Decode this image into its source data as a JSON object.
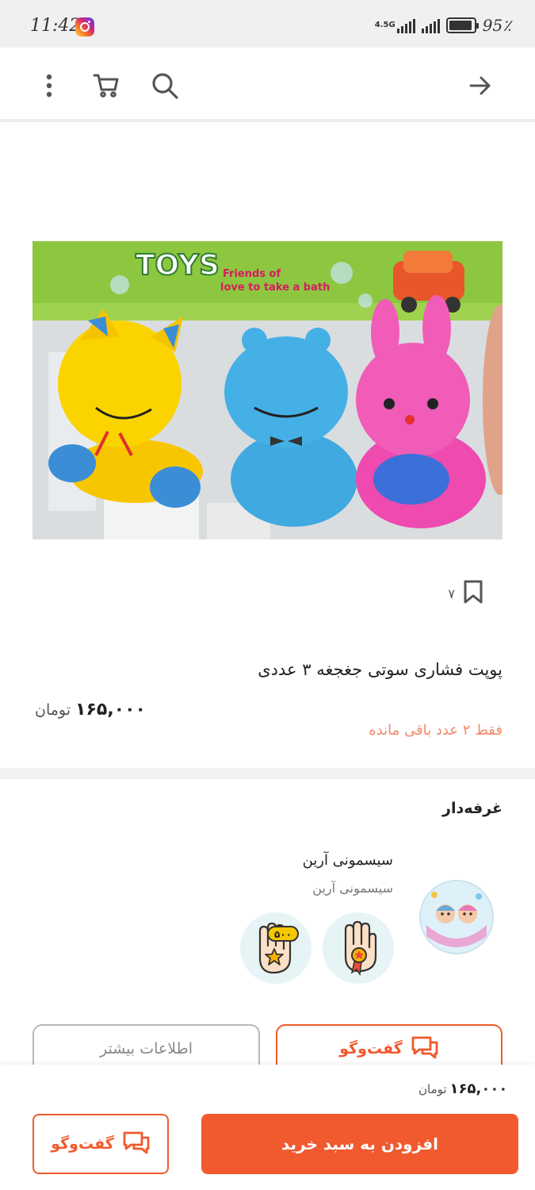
{
  "status_bar": {
    "time": "11:42",
    "network": "4.5G",
    "battery_percent": "95٪",
    "battery_level": 0.95
  },
  "toolbar": {
    "icons": [
      "more-vert-icon",
      "cart-icon",
      "search-icon",
      "arrow-right-icon"
    ]
  },
  "product": {
    "image_text": {
      "brand": "TOYS",
      "tagline_1": "Friends of",
      "tagline_2": "love to take a bath"
    },
    "bookmark_count": "۷",
    "title": "پوپت فشاری سوتی جغجغه ۳ عددی",
    "price": "۱۶۵,۰۰۰",
    "currency": "تومان",
    "stock_note": "فقط ۲ عدد باقی مانده"
  },
  "vendor": {
    "heading": "غرفه‌دار",
    "name": "سیسمونی آرین",
    "subtitle": "سیسمونی آرین",
    "badge_500_text": "۵۰۰",
    "buttons": {
      "chat": "گفت‌وگو",
      "more_info": "اطلاعات بیشتر"
    }
  },
  "bottom_bar": {
    "price": "۱۶۵,۰۰۰",
    "currency": "تومان",
    "chat_label": "گفت‌وگو",
    "add_to_cart_label": "افزودن به سبد خرید"
  },
  "colors": {
    "accent": "#f05a2e",
    "stock_note": "#ef8a6b",
    "badge_bg": "#e6f4f6"
  }
}
